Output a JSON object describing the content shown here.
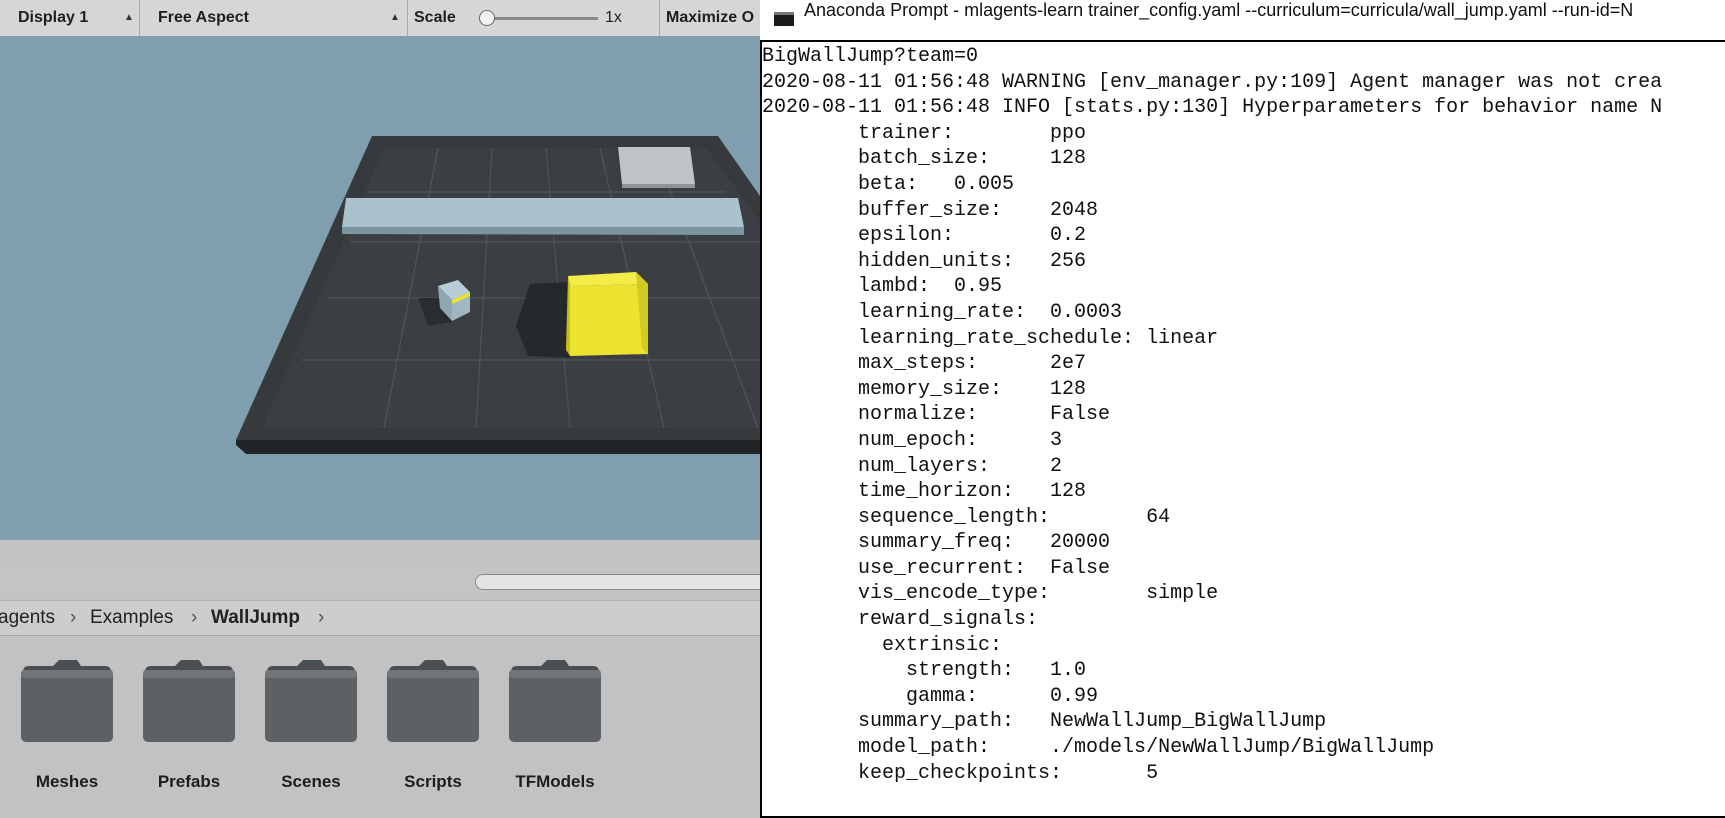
{
  "unity": {
    "toolbar": {
      "display": "Display 1",
      "aspect": "Free Aspect",
      "scale_label": "Scale",
      "scale_value": 0.05,
      "scale_text": "1x",
      "maximize": "Maximize O"
    },
    "breadcrumb": {
      "items": [
        "agents",
        "Examples",
        "WallJump"
      ]
    },
    "folders": [
      "Meshes",
      "Prefabs",
      "Scenes",
      "Scripts",
      "TFModels"
    ],
    "colors": {
      "sky": "#7f9fae",
      "floor": "#363a3d",
      "wall": "#a9c2cc",
      "block": "#ece32f",
      "panel": "#c2c2c2"
    }
  },
  "console": {
    "title": "Anaconda Prompt - mlagents-learn  trainer_config.yaml --curriculum=curricula/wall_jump.yaml --run-id=N",
    "lines": [
      "BigWallJump?team=0",
      "2020-08-11 01:56:48 WARNING [env_manager.py:109] Agent manager was not crea",
      "2020-08-11 01:56:48 INFO [stats.py:130] Hyperparameters for behavior name N",
      "        trainer:        ppo",
      "        batch_size:     128",
      "        beta:   0.005",
      "        buffer_size:    2048",
      "        epsilon:        0.2",
      "        hidden_units:   256",
      "        lambd:  0.95",
      "        learning_rate:  0.0003",
      "        learning_rate_schedule: linear",
      "        max_steps:      2e7",
      "        memory_size:    128",
      "        normalize:      False",
      "        num_epoch:      3",
      "        num_layers:     2",
      "        time_horizon:   128",
      "        sequence_length:        64",
      "        summary_freq:   20000",
      "        use_recurrent:  False",
      "        vis_encode_type:        simple",
      "        reward_signals:",
      "          extrinsic:",
      "            strength:   1.0",
      "            gamma:      0.99",
      "        summary_path:   NewWallJump_BigWallJump",
      "        model_path:     ./models/NewWallJump/BigWallJump",
      "        keep_checkpoints:       5"
    ]
  }
}
